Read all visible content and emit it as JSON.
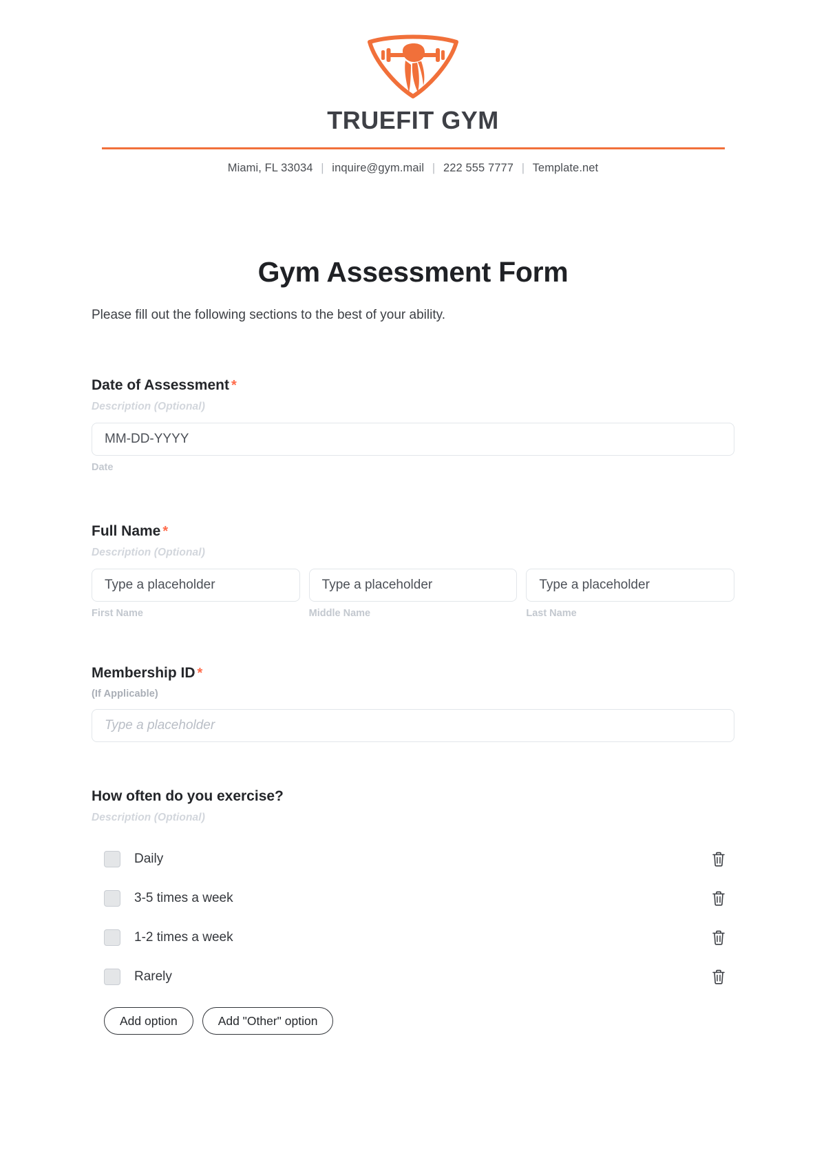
{
  "header": {
    "logo_icon": "gym-shield-barbell-logo",
    "brand_name": "TRUEFIT GYM",
    "contact": {
      "address": "Miami, FL 33034",
      "email": "inquire@gym.mail",
      "phone": "222 555 7777",
      "website": "Template.net",
      "separator": "|"
    },
    "accent_color": "#f1703a"
  },
  "title": "Gym Assessment Form",
  "subtitle": "Please fill out the following sections to the best of your ability.",
  "fields": {
    "date_of_assessment": {
      "label": "Date of Assessment",
      "required_marker": "*",
      "description": "Description (Optional)",
      "input_value": "MM-DD-YYYY",
      "caption": "Date"
    },
    "full_name": {
      "label": "Full Name",
      "required_marker": "*",
      "description": "Description (Optional)",
      "parts": [
        {
          "placeholder": "Type a placeholder",
          "caption": "First Name"
        },
        {
          "placeholder": "Type a placeholder",
          "caption": "Middle Name"
        },
        {
          "placeholder": "Type a placeholder",
          "caption": "Last Name"
        }
      ]
    },
    "membership_id": {
      "label": "Membership ID",
      "required_marker": "*",
      "description": "(If Applicable)",
      "placeholder": "Type a placeholder"
    },
    "exercise_frequency": {
      "label": "How often do you exercise?",
      "description": "Description (Optional)",
      "options": [
        {
          "label": "Daily",
          "checked": false,
          "delete_icon": "trash-icon"
        },
        {
          "label": "3-5 times a week",
          "checked": false,
          "delete_icon": "trash-icon"
        },
        {
          "label": "1-2 times a week",
          "checked": false,
          "delete_icon": "trash-icon"
        },
        {
          "label": "Rarely",
          "checked": false,
          "delete_icon": "trash-icon"
        }
      ],
      "add_option_label": "Add option",
      "add_other_option_label": "Add \"Other\" option"
    }
  }
}
